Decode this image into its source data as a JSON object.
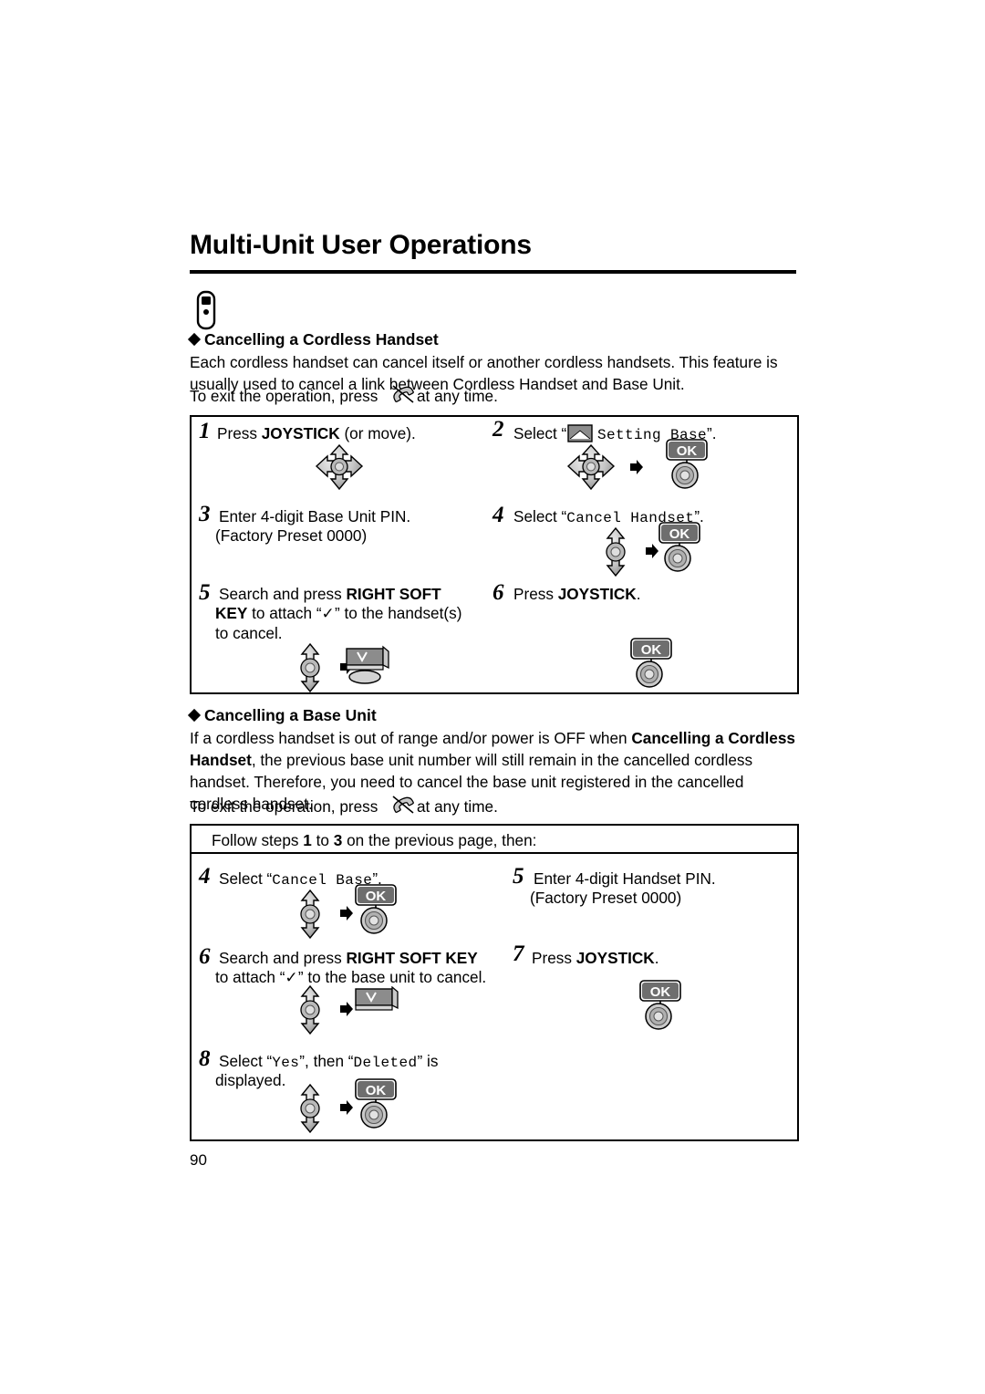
{
  "page": {
    "title": "Multi-Unit User Operations",
    "number": "90"
  },
  "section1": {
    "heading_prefix": "Cancelling a ",
    "heading_rest": "Cordless Handset",
    "body": "Each cordless handset can cancel itself or another cordless handsets. This feature is usually used to cancel a link between Cordless Handset and Base Unit.",
    "exit_prefix": "To exit the operation, press",
    "exit_suffix": "at any time.",
    "steps": [
      {
        "num": "1",
        "text_pre": "Press ",
        "text_bold": "JOYSTICK",
        "text_post": " (or move)."
      },
      {
        "num": "2",
        "text_pre": "Select “",
        "icon": "envelope-icon",
        "mono": "Setting Base",
        "text_post": "”."
      },
      {
        "num": "3",
        "line1": "Enter 4-digit Base Unit PIN.",
        "line2": "(Factory Preset 0000)"
      },
      {
        "num": "4",
        "text_pre": "Select “",
        "mono": "Cancel Handset",
        "text_post": "”."
      },
      {
        "num": "5",
        "line1_pre": "Search and press ",
        "line1_bold": "RIGHT SOFT",
        "line2_bold": "KEY",
        "line2_post": " to attach “✓” to the handset(s)",
        "line3": "to cancel."
      },
      {
        "num": "6",
        "text_pre": "Press ",
        "text_bold": "JOYSTICK",
        "text_post": "."
      }
    ]
  },
  "section2": {
    "heading": "Cancelling a Base Unit",
    "body_pre": "If a cordless handset is out of range and/or power is OFF when ",
    "body_bold1": "Cancelling a Cordless Handset",
    "body_mid": ", the previous base unit number will still remain in the cancelled cordless handset. Therefore, you need to cancel the base unit registered in the cancelled cordless handset.",
    "exit_prefix": "To exit the operation, press",
    "exit_suffix": "at any time.",
    "follow_pre": "Follow steps ",
    "follow_n1": "1",
    "follow_mid": " to ",
    "follow_n2": "3",
    "follow_post": " on the previous page, then:",
    "steps": [
      {
        "num": "4",
        "text_pre": "Select “",
        "mono": "Cancel Base",
        "text_post": "”."
      },
      {
        "num": "5",
        "line1": "Enter 4-digit Handset PIN.",
        "line2": "(Factory Preset 0000)"
      },
      {
        "num": "6",
        "line1_pre": "Search and press ",
        "line1_bold": "RIGHT SOFT KEY",
        "line2": "to attach “✓” to the base unit to cancel."
      },
      {
        "num": "7",
        "text_pre": "Press ",
        "text_bold": "JOYSTICK",
        "text_post": "."
      },
      {
        "num": "8",
        "line1_pre": "Select “",
        "line1_mono": "Yes",
        "line1_mid": "”, then “",
        "line1_mono2": "Deleted",
        "line1_post": "” is",
        "line2": "displayed."
      }
    ]
  },
  "icons": {
    "joystick": "joystick-icon",
    "ok_label": "OK",
    "arrow": "arrow-right-icon",
    "phone_off": "phone-off-icon",
    "soft_key": "soft-key-icon",
    "handset": "handset-icon"
  },
  "colors": {
    "ink": "#000000",
    "paper": "#ffffff",
    "grey_mid": "#a8a8a8",
    "grey_light": "#d8d8d8",
    "grey_dark": "#6e6e6e"
  }
}
